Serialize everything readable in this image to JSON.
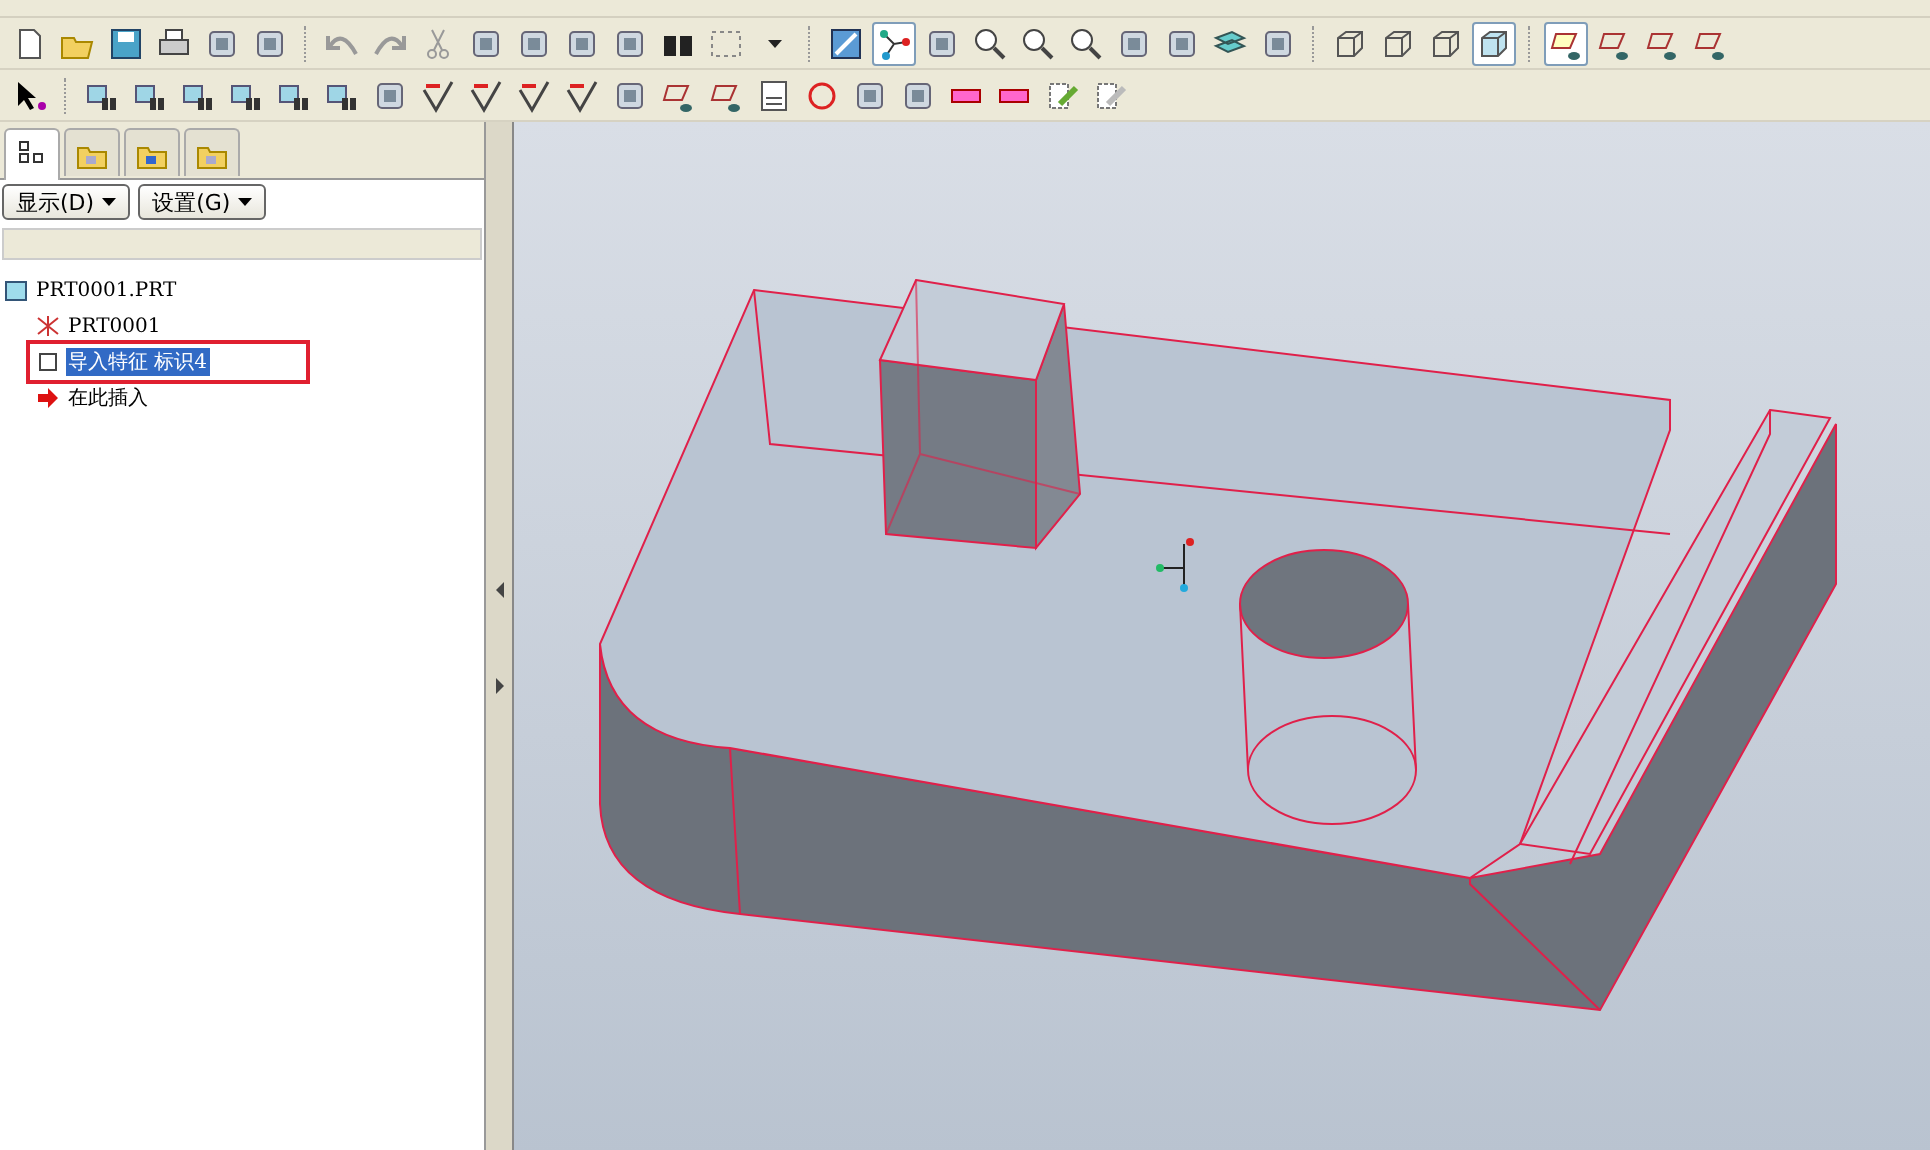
{
  "toolbar_rows": [
    {
      "buttons": [
        {
          "pressed": false
        },
        {
          "pressed": false
        },
        {
          "pressed": false
        },
        {
          "pressed": false
        },
        {
          "pressed": false
        },
        {
          "pressed": false
        },
        {
          "pressed": false
        },
        {
          "pressed": false
        },
        {
          "pressed": false
        },
        {
          "pressed": false
        },
        {
          "pressed": false
        },
        {
          "pressed": false
        },
        {
          "pressed": false
        },
        {
          "pressed": false
        },
        {
          "pressed": false
        },
        {
          "pressed": false
        },
        {
          "pressed": false
        },
        {
          "pressed": true
        },
        {
          "pressed": false
        },
        {
          "pressed": false
        },
        {
          "pressed": false
        },
        {
          "pressed": false
        },
        {
          "pressed": false
        },
        {
          "pressed": false
        },
        {
          "pressed": false
        },
        {
          "pressed": false
        },
        {
          "pressed": false
        },
        {
          "pressed": false
        },
        {
          "pressed": false
        },
        {
          "pressed": true
        },
        {
          "pressed": true
        },
        {
          "pressed": false
        },
        {
          "pressed": false
        },
        {
          "pressed": false
        }
      ]
    },
    {
      "buttons": [
        {
          "pressed": false
        },
        {
          "pressed": false
        },
        {
          "pressed": false
        },
        {
          "pressed": false
        },
        {
          "pressed": false
        },
        {
          "pressed": false
        },
        {
          "pressed": false
        },
        {
          "pressed": false
        },
        {
          "pressed": false
        },
        {
          "pressed": false
        },
        {
          "pressed": false
        },
        {
          "pressed": false
        },
        {
          "pressed": false
        },
        {
          "pressed": false
        },
        {
          "pressed": false
        },
        {
          "pressed": false
        },
        {
          "pressed": false
        },
        {
          "pressed": false
        },
        {
          "pressed": false
        },
        {
          "pressed": false
        },
        {
          "pressed": false
        },
        {
          "pressed": false
        },
        {
          "pressed": false
        }
      ]
    }
  ],
  "panel_tabs": [
    {
      "selected": true
    },
    {
      "selected": false
    },
    {
      "selected": false
    },
    {
      "selected": false
    }
  ],
  "panel_buttons": [
    {
      "label": "显示(D)"
    },
    {
      "label": "设置(G)"
    }
  ],
  "model_tree": [
    {
      "label": "PRT0001.PRT",
      "kind": "part",
      "selected": false,
      "children": [
        {
          "label": "PRT0001",
          "kind": "csys",
          "selected": false
        },
        {
          "label": "导入特征 标识4",
          "kind": "feature",
          "selected": true
        },
        {
          "label": "在此插入",
          "kind": "insert",
          "selected": false
        }
      ]
    }
  ]
}
